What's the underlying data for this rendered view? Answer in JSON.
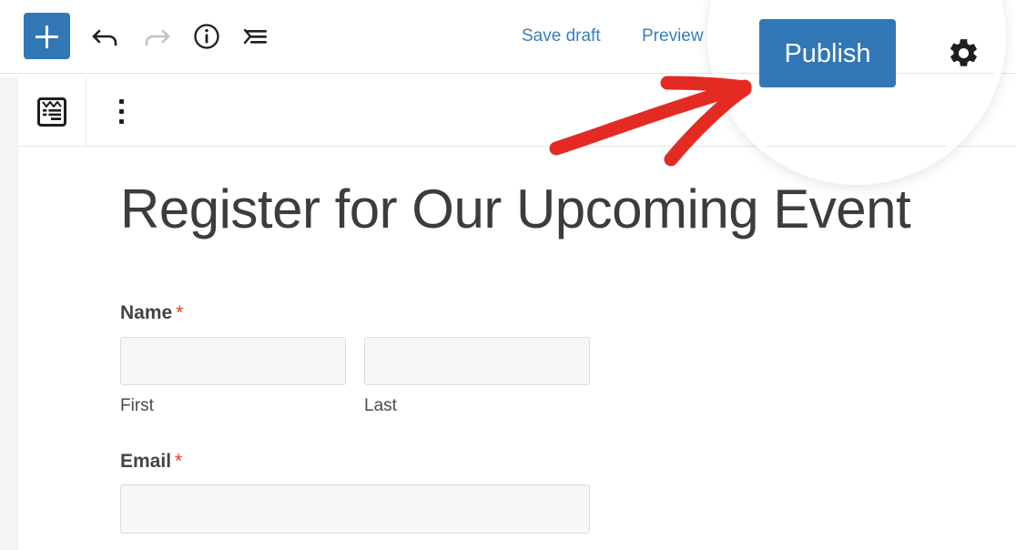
{
  "editor": {
    "add_block": {
      "label": "+",
      "icon": "plus-icon",
      "color": "#3277b5"
    },
    "undo": {
      "icon": "undo-icon",
      "enabled": true
    },
    "redo": {
      "icon": "redo-icon",
      "enabled": false
    },
    "details": {
      "icon": "info-icon"
    },
    "outline": {
      "icon": "list-view-icon"
    },
    "save_draft_label": "Save draft",
    "preview_label": "Preview",
    "publish_label": "Publish",
    "settings": {
      "icon": "gear-icon"
    }
  },
  "block_toolbar": {
    "block_icon": "wpforms-block-icon",
    "more_options": {
      "icon": "vertical-dots-icon"
    }
  },
  "form": {
    "title": "Register for Our Upcoming Event",
    "fields": [
      {
        "label": "Name",
        "required_marker": "*",
        "type": "name",
        "sub_fields": [
          {
            "sub_label": "First",
            "value": "",
            "placeholder": ""
          },
          {
            "sub_label": "Last",
            "value": "",
            "placeholder": ""
          }
        ]
      },
      {
        "label": "Email",
        "required_marker": "*",
        "type": "email",
        "value": "",
        "placeholder": ""
      }
    ]
  },
  "annotation": {
    "type": "arrow",
    "color": "#e32b24",
    "points_at": "publish-button",
    "lens": {
      "shape": "circle",
      "highlights": "publish-button"
    }
  },
  "colors": {
    "accent_blue": "#3277b5",
    "link_blue": "#3a7cbe",
    "required_red": "#e2401c",
    "annotation_red": "#e32b24",
    "input_bg": "#f7f7f7",
    "input_border": "#dcdcdc",
    "rule": "#e6e6e6",
    "gutter": "#f4f4f4"
  }
}
